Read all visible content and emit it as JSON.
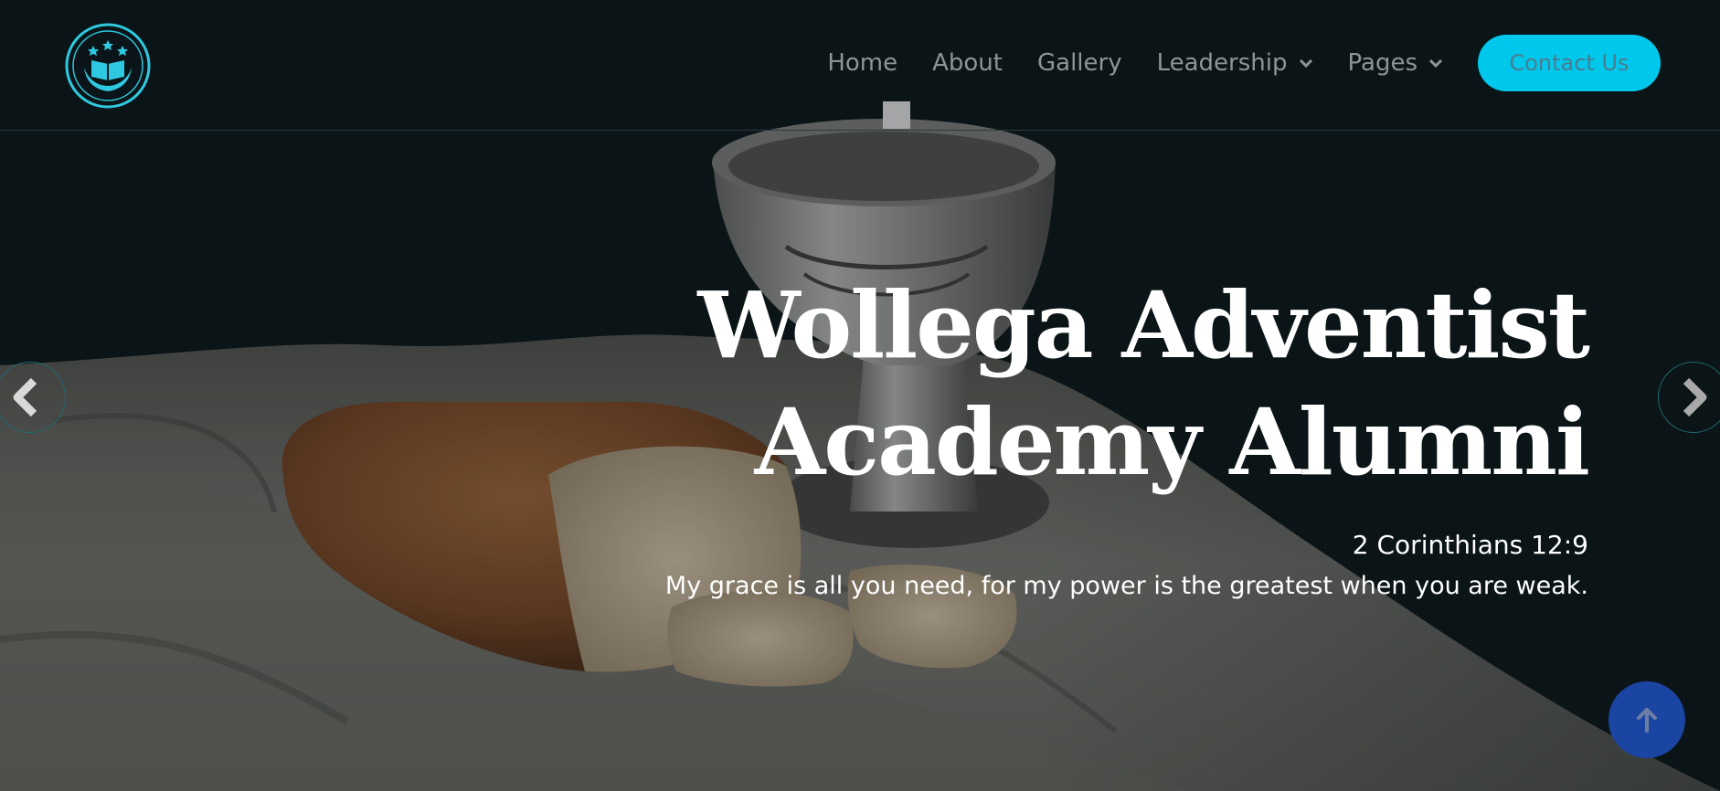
{
  "nav": {
    "items": [
      {
        "label": "Home",
        "has_dropdown": false
      },
      {
        "label": "About",
        "has_dropdown": false
      },
      {
        "label": "Gallery",
        "has_dropdown": false
      },
      {
        "label": "Leadership",
        "has_dropdown": true
      },
      {
        "label": "Pages",
        "has_dropdown": true
      }
    ],
    "contact_label": "Contact Us"
  },
  "logo": {
    "icon": "open-book-hands-seal-icon"
  },
  "hero": {
    "title_line1": "Wollega Adventist",
    "title_line2": "Academy Alumni",
    "verse_ref": "2 Corinthians 12:9",
    "verse_text": "My grace is all you need, for my power is the greatest when you are weak."
  },
  "controls": {
    "prev_icon": "chevron-left-icon",
    "next_icon": "chevron-right-icon",
    "back_to_top_icon": "arrow-up-icon"
  },
  "colors": {
    "background": "#0b1418",
    "accent": "#00c7ec",
    "nav_text": "#8e9599",
    "back_to_top": "#1b45a3"
  }
}
